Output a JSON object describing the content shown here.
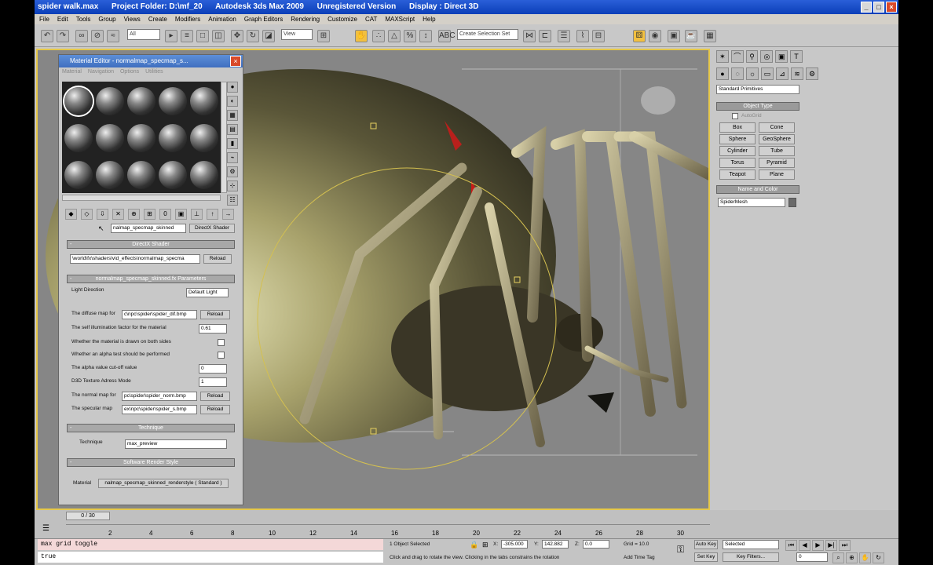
{
  "window": {
    "title_file": "spider walk.max",
    "title_project": "Project Folder: D:\\mf_20",
    "title_app": "Autodesk 3ds Max  2009",
    "title_license": "Unregistered Version",
    "title_display": "Display : Direct 3D"
  },
  "menu": [
    "File",
    "Edit",
    "Tools",
    "Group",
    "Views",
    "Create",
    "Modifiers",
    "Animation",
    "Graph Editors",
    "Rendering",
    "Customize",
    "CAT",
    "MAXScript",
    "Help"
  ],
  "toolbar": {
    "filter_value": "All",
    "refcoord_value": "View",
    "selection_set_placeholder": "Create Selection Set"
  },
  "material_editor": {
    "title": "Material Editor - normalmap_specmap_s...",
    "menu": [
      "Material",
      "Navigation",
      "Options",
      "Utilities"
    ],
    "material_name": "nalmap_specmap_skinned",
    "material_type": "DirectX Shader",
    "directx_shader_header": "DirectX Shader",
    "fx_path": "\\world\\fx\\shaders\\vid_effects\\normalmap_specma",
    "reload": "Reload",
    "params_header": "normalmap_specmap_skinned.fx Parameters",
    "light_direction_label": "Light Direction",
    "light_direction_value": "Default Light",
    "diffuse_label": "The diffuse map for",
    "diffuse_value": "c\\npc\\spider\\spider_dif.bmp",
    "selfillum_label": "The self illumination factor for the material",
    "selfillum_value": "0.61",
    "twosided_label": "Whether the material is drawn on both sides",
    "alphatest_label": "Whether an alpha test should be performed",
    "alpha_cutoff_label": "The alpha value cut-off value",
    "alpha_cutoff_value": "0",
    "texture_address_label": "D3D Texture Adress Mode",
    "texture_address_value": "1",
    "normal_label": "The normal map for",
    "normal_value": "pc\\spider\\spider_norm.bmp",
    "specular_label": "The specular map",
    "specular_value": "ex\\npc\\spider\\spider_s.bmp",
    "technique_header": "Technique",
    "technique_label": "Technique",
    "technique_value": "max_preview",
    "software_render_header": "Software Render Style",
    "software_material_label": "Material",
    "software_material_value": "nalmap_specmap_skinned_renderstyle  ( Standard )"
  },
  "command_panel": {
    "category_value": "Standard Primitives",
    "object_type_header": "Object Type",
    "autogrid_label": "AutoGrid",
    "object_buttons": [
      "Box",
      "Cone",
      "Sphere",
      "GeoSphere",
      "Cylinder",
      "Tube",
      "Torus",
      "Pyramid",
      "Teapot",
      "Plane"
    ],
    "name_color_header": "Name and Color",
    "object_name": "SpiderMesh",
    "color_swatch": "#6a6a6a"
  },
  "timeline": {
    "slider_label": "0 / 30",
    "ticks": [
      "2",
      "4",
      "6",
      "8",
      "10",
      "12",
      "14",
      "16",
      "18",
      "20",
      "22",
      "24",
      "26",
      "28",
      "30"
    ]
  },
  "status": {
    "listener_line1": "max grid toggle",
    "listener_line2": "true",
    "selection": "1 Object Selected",
    "x_value": "-305.000",
    "y_value": "142.882",
    "z_value": "0.0",
    "grid": "Grid = 10.0",
    "prompt": "Click and drag to rotate the view.  Clicking in the tabs constrains the rotation",
    "add_time_tag": "Add Time Tag",
    "auto_key": "Auto Key",
    "selected_value": "Selected",
    "set_key": "Set Key",
    "key_filters": "Key Filters...",
    "frame_value": "0"
  }
}
